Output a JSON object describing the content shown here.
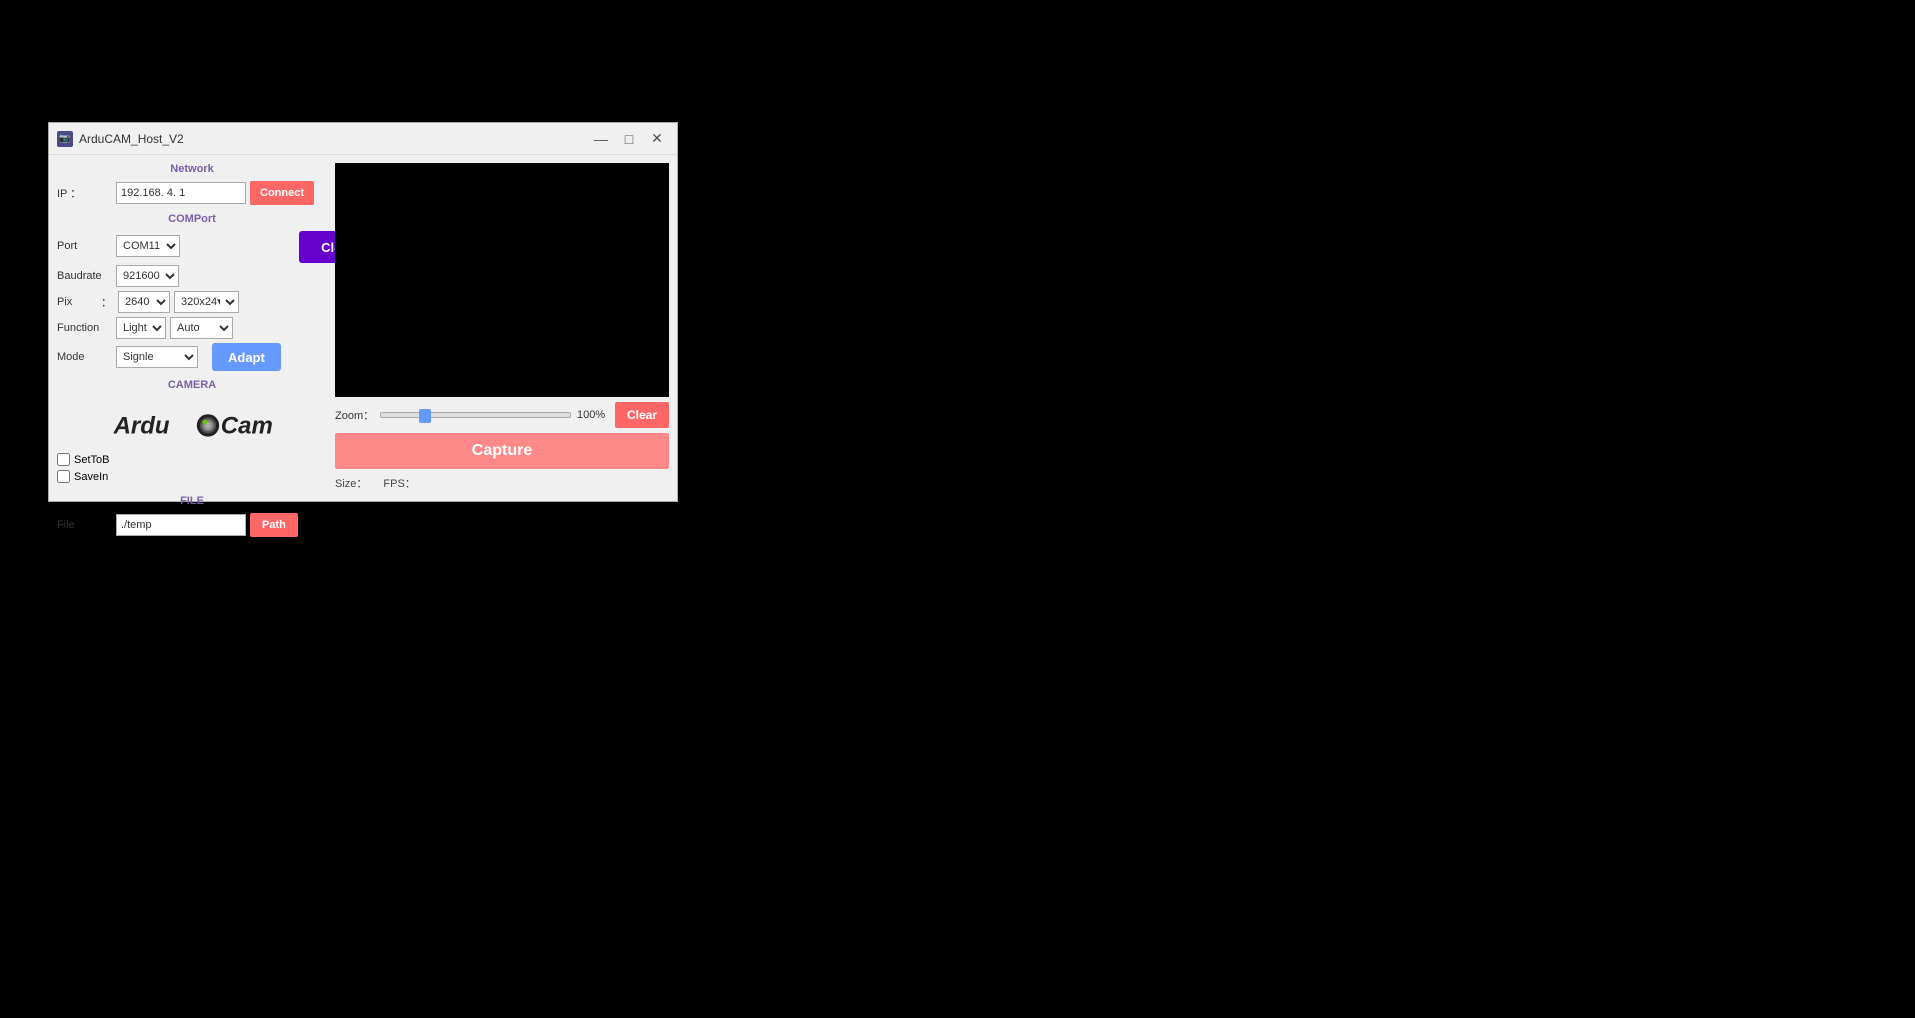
{
  "window": {
    "title": "ArduCAM_Host_V2",
    "icon": "📷"
  },
  "titlebar": {
    "minimize_label": "—",
    "maximize_label": "□",
    "close_label": "✕"
  },
  "network": {
    "section_label": "Network",
    "ip_label": "IP  ：",
    "ip_value": "192.168. 4. 1",
    "connect_label": "Connect"
  },
  "comport": {
    "section_label": "COMPort",
    "close_label": "Close",
    "port_label": "Port",
    "port_value": "COM11",
    "baudrate_label": "Baudrate",
    "baudrate_value": "921600",
    "pix_label": "Pix",
    "pix_value": "2640",
    "pix_size_value": "320x24",
    "function_label": "Function",
    "function_value": "Light",
    "function_option2": "Auto",
    "mode_label": "Mode",
    "mode_value": "Signle",
    "adapt_label": "Adapt"
  },
  "camera": {
    "section_label": "CAMERA",
    "logo_text_ardu": "Ardu",
    "logo_text_cam": "Cam"
  },
  "checkboxes": {
    "setTOB_label": "SetToB",
    "saveIn_label": "SaveIn"
  },
  "file": {
    "section_label": "FILE",
    "file_label": "File",
    "file_value": "./temp",
    "path_label": "Path"
  },
  "preview": {
    "zoom_label": "Zoom：",
    "zoom_percent": "100%",
    "clear_label": "Clear",
    "capture_label": "Capture",
    "size_label": "Size：",
    "fps_label": "FPS："
  }
}
